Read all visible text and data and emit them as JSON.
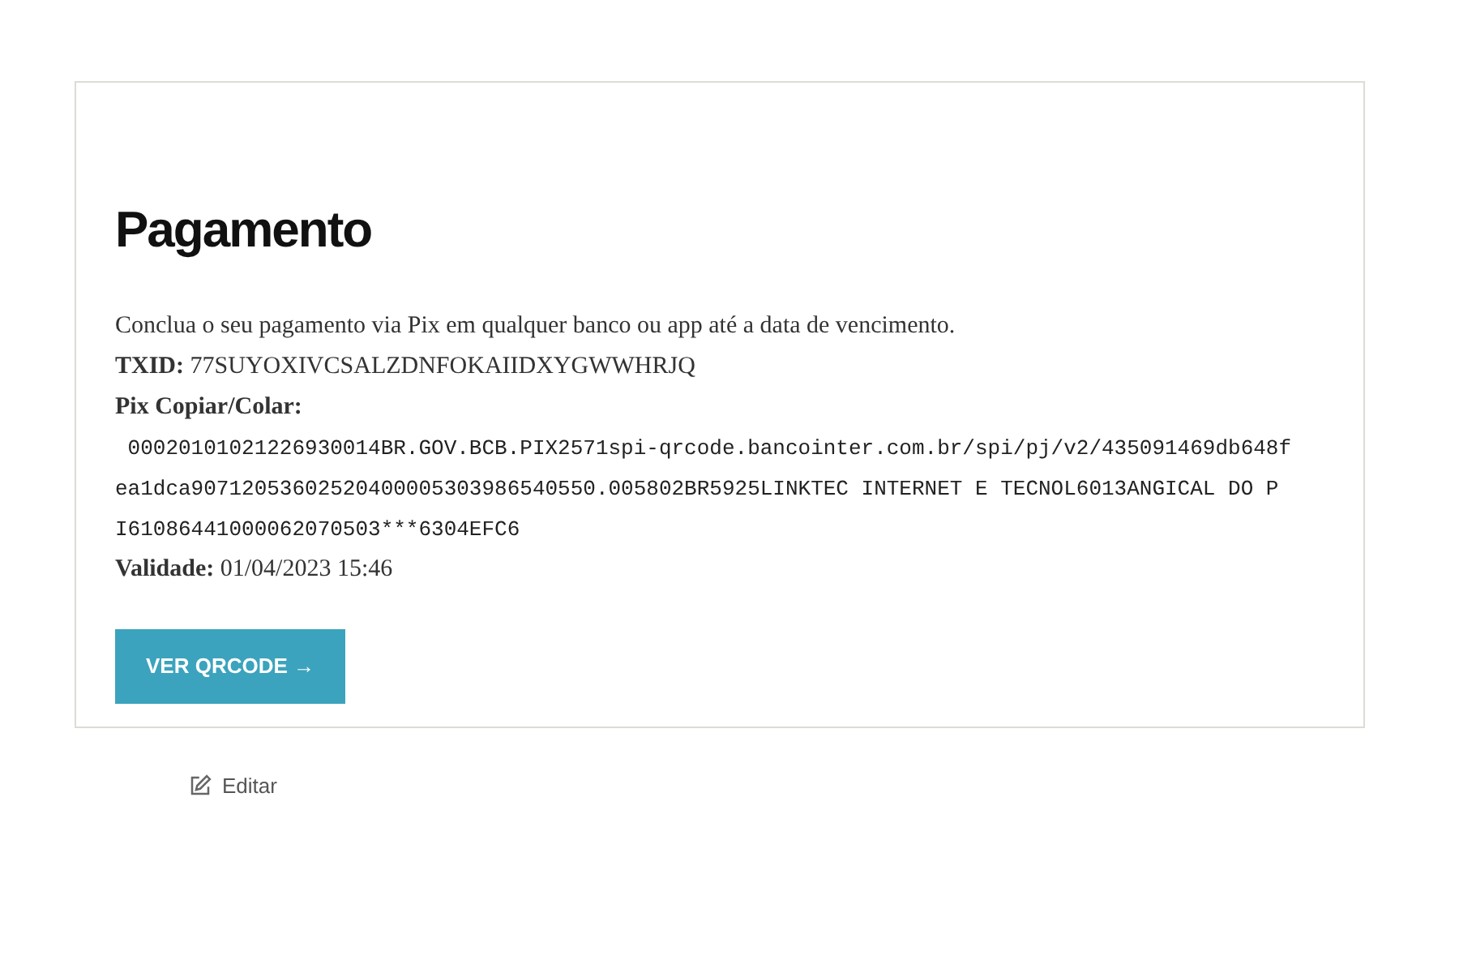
{
  "card": {
    "title": "Pagamento",
    "intro": "Conclua o seu pagamento via Pix em qualquer banco ou app até a data de vencimento.",
    "txid": {
      "label": "TXID:",
      "value": "77SUYOXIVCSALZDNFOKAIIDXYGWWHRJQ"
    },
    "pix": {
      "label": "Pix Copiar/Colar:",
      "lines": [
        " 00020101021226930014BR.GOV.BCB.PIX2571spi-qrcode.bancointer.com.br/spi/pj/v2/435091469db648f",
        "ea1dca90712053602520400005303986540550.005802BR5925LINKTEC INTERNET E TECNOL6013ANGICAL DO P",
        "I61086441000062070503***6304EFC6"
      ]
    },
    "validade": {
      "label": "Validade:",
      "value": "01/04/2023 15:46"
    },
    "button": "VER QRCODE →"
  },
  "edit_link": "Editar"
}
